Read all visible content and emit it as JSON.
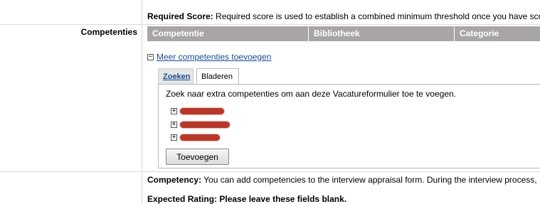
{
  "required_score": {
    "label": "Required Score:",
    "text": "Required score is used to establish a combined minimum threshold once you have sco"
  },
  "competencies_row": {
    "label": "Competenties",
    "columns": [
      "Competentie",
      "Bibliotheek",
      "Categorie"
    ],
    "more_link": "Meer competenties toevoegen",
    "tabs": [
      {
        "label": "Zoeken"
      },
      {
        "label": "Bladeren"
      }
    ],
    "browse_text": "Zoek naar extra competenties om aan deze Vacatureformulier toe te voegen.",
    "tree_items": [
      {
        "label": ""
      },
      {
        "label": ""
      },
      {
        "label": ""
      }
    ],
    "add_button": "Toevoegen"
  },
  "competency_note": {
    "label": "Competency:",
    "text": "You can add competencies to the interview appraisal form. During the interview process,"
  },
  "expected_rating": {
    "text": "Expected Rating: Please leave these fields blank."
  },
  "colors": {
    "header_bg": "#a8a5a5",
    "link": "#1a4f8f",
    "redaction": "#b6382b"
  }
}
